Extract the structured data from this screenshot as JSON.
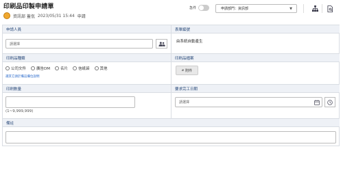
{
  "header": {
    "title": "印刷品印製申請單",
    "applicant_name": "資訊部 蓋佤",
    "datetime": "2023/05/31 15:44",
    "status": "申請",
    "bookmark_label": "急件",
    "department_select": "申請部門：資訊部"
  },
  "form": {
    "applicant": {
      "label": "申請人員",
      "placeholder": "請選擇"
    },
    "form_number": {
      "label": "表單編號",
      "value": "由系統自動產生"
    },
    "print_type": {
      "label": "印刷品種類",
      "options": [
        "公司文件",
        "廣告DM",
        "名片",
        "信紙袋",
        "其他"
      ],
      "hint": "選其它請於備註欄位說明"
    },
    "print_file": {
      "label": "印刷品檔案",
      "attach_label": "附件"
    },
    "quantity": {
      "label": "印刷數量",
      "range_note": "(1~9,999,999)"
    },
    "due_date": {
      "label": "要求完工日期",
      "placeholder": "請選擇"
    },
    "remarks": {
      "label": "備註"
    }
  },
  "colors": {
    "header_bg": "#eef1f6",
    "header_text": "#2a4a7a",
    "link": "#2a6acb"
  }
}
